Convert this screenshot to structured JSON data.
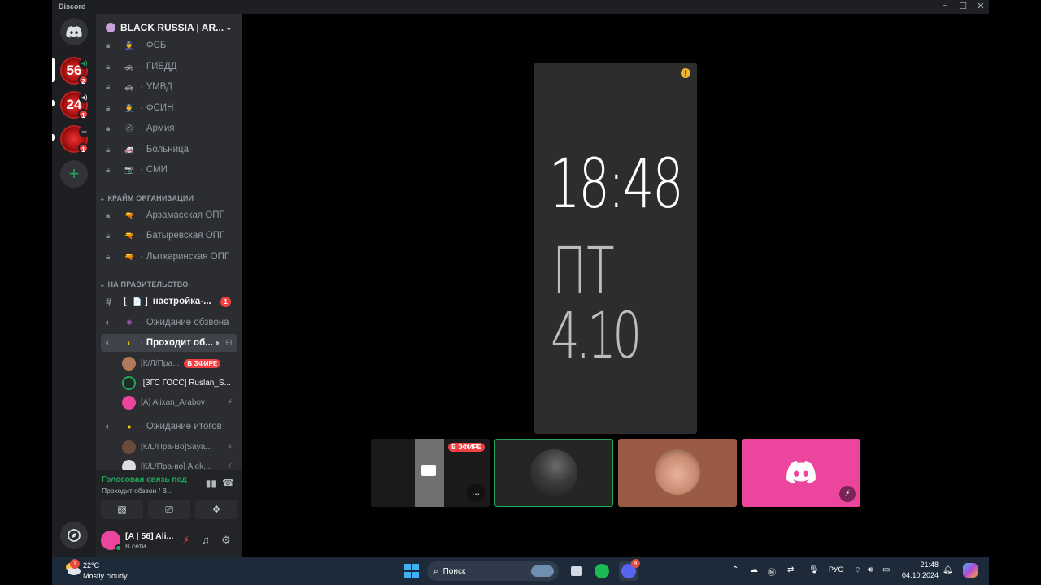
{
  "window": {
    "title": "Discord"
  },
  "servers": [
    {
      "label": "56",
      "badge": "2"
    },
    {
      "label": "24",
      "badge": "1"
    },
    {
      "label": "",
      "badge": "1"
    }
  ],
  "guild": {
    "name": "BLACK RUSSIA | AR..."
  },
  "channels_top": [
    {
      "name": "ФСБ"
    },
    {
      "name": "ГИБДД"
    },
    {
      "name": "УМВД"
    },
    {
      "name": "ФСИН"
    },
    {
      "name": "Армия"
    },
    {
      "name": "Больница"
    },
    {
      "name": "СМИ"
    }
  ],
  "categories": {
    "crime": "КРАЙМ ОРГАНИЗАЦИИ",
    "gov": "НА ПРАВИТЕЛЬСТВО"
  },
  "channels_crime": [
    {
      "name": "Арзамасская ОПГ"
    },
    {
      "name": "Батыревская ОПГ"
    },
    {
      "name": "Лыткаринская ОПГ"
    }
  ],
  "channels_gov": {
    "text_channel": "настройка-...",
    "text_bracket": "[",
    "text_bracket_close": "]",
    "text_badge": "1",
    "voice1": "Ожидание обзвона",
    "voice2": "Проходит об...",
    "voice3": "Ожидание итогов"
  },
  "voice_users_1": [
    {
      "name": "[К/Л/Пра...",
      "live": "В ЭФИРЕ"
    },
    {
      "name": ".[ЗГС ГОСС] Ruslan_S..."
    },
    {
      "name": "[A] Alixan_Arabov"
    }
  ],
  "voice_users_3": [
    {
      "name": "[К/L/Пра-Во]Saya..."
    },
    {
      "name": "[К/L/Пра-во] Alek..."
    }
  ],
  "voice_panel": {
    "title": "Голосовая связь под",
    "subtitle": "Проходит обзвон / B..."
  },
  "user": {
    "name": "[A | 56] Ali...",
    "status": "В сети"
  },
  "stream": {
    "warning": "!",
    "time": "18:48",
    "day": "ПТ",
    "date": "4.10"
  },
  "tiles": {
    "live_label": "В ЭФИРЕ",
    "more": "..."
  },
  "taskbar": {
    "weather_badge": "1",
    "temp": "22°C",
    "desc": "Mostly cloudy",
    "search": "Поиск",
    "discord_badge": "4",
    "lang": "РУС",
    "time": "21:48",
    "date": "04.10.2024"
  },
  "colors": {
    "accent": "#5865f2",
    "live": "#f23f43",
    "online": "#23a55a",
    "pink": "#eb459e"
  }
}
